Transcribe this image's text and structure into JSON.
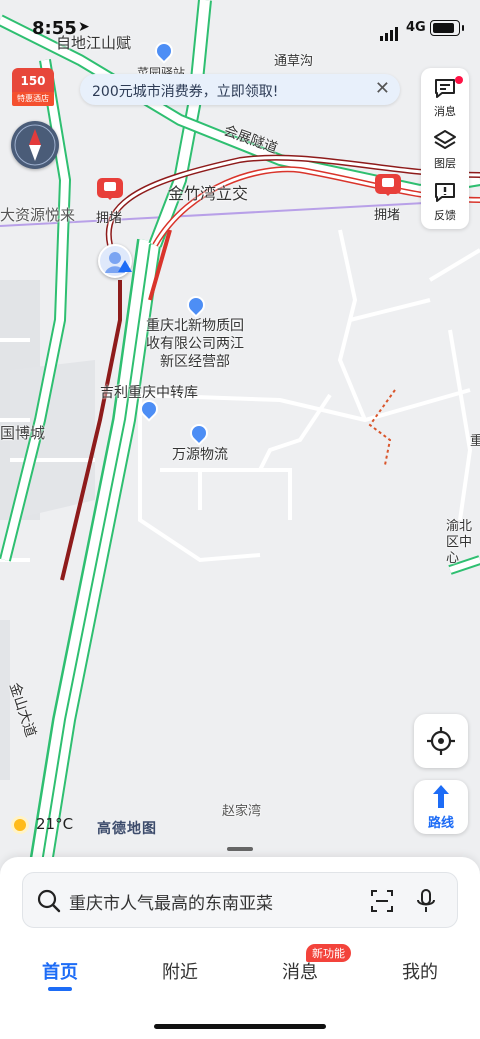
{
  "status_bar": {
    "time": "8:55",
    "network": "4G"
  },
  "banner": {
    "text": "200元城市消费券，立即领取!"
  },
  "hotel_badge": {
    "price": "150",
    "label": "特惠酒店"
  },
  "toolbox": {
    "messages": "消息",
    "layers": "图层",
    "feedback": "反馈"
  },
  "map": {
    "labels": {
      "jiangshan": "自地江山赋",
      "tongcaogou": "通草沟",
      "caiyuanyizhan": "菜园驿站",
      "huizhan_tunnel": "会展隧道",
      "jinzhuwan": "金竹湾立交",
      "congestion_left": "拥堵",
      "congestion_right": "拥堵",
      "ziyuan": "大资源悦来",
      "wuliu_center": "重庆北新物质回收有限公司两江新区经营部",
      "jili": "吉利重庆中转库",
      "wanyuan": "万源物流",
      "bocheng": "国博城",
      "right_edge_1": "重庆",
      "right_edge_2": "渝北区中心",
      "jinshan_road": "金山大道",
      "zhaojiawan": "赵家湾"
    }
  },
  "weather": {
    "temp": "21°C"
  },
  "brand": "高德地图",
  "route_button": {
    "label": "路线"
  },
  "search": {
    "placeholder": "重庆市人气最高的东南亚菜"
  },
  "tabs": [
    {
      "label": "首页"
    },
    {
      "label": "附近"
    },
    {
      "label": "消息",
      "badge": "新功能"
    },
    {
      "label": "我的"
    }
  ],
  "colors": {
    "accent": "#1d6cf6",
    "road_green": "#2fbf71",
    "road_red": "#d9342b",
    "road_darkred": "#8e1b1b"
  }
}
